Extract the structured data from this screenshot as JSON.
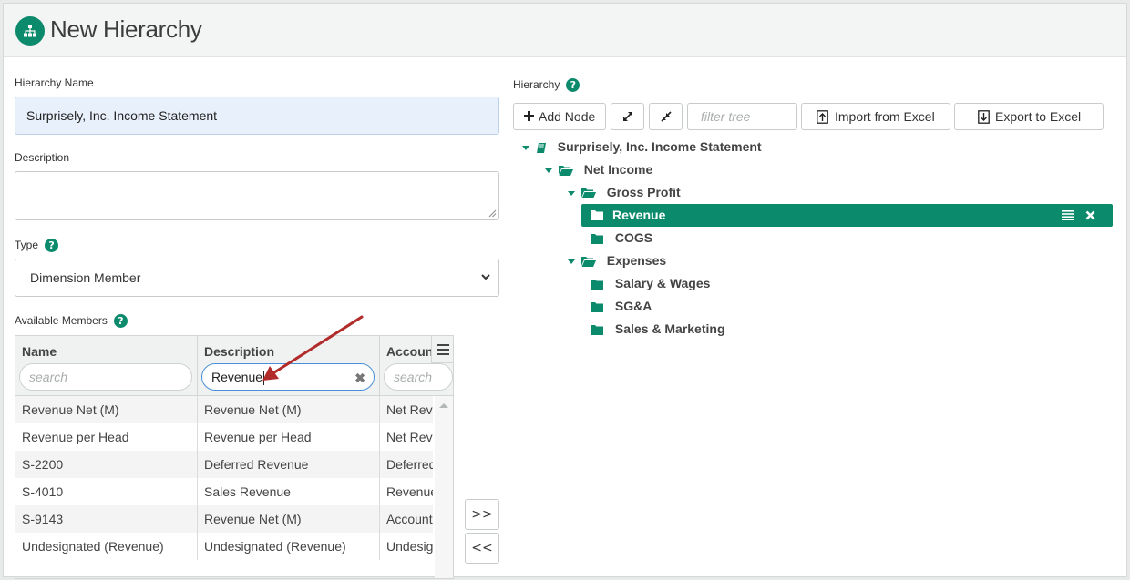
{
  "header": {
    "title": "New Hierarchy",
    "icon": "hierarchy-icon"
  },
  "form": {
    "name_label": "Hierarchy Name",
    "name_value": "Surprisely, Inc. Income Statement",
    "description_label": "Description",
    "description_value": "",
    "type_label": "Type",
    "type_value": "Dimension Member",
    "members_label": "Available Members"
  },
  "grid": {
    "columns": [
      {
        "title": "Name",
        "filter": "",
        "placeholder": "search"
      },
      {
        "title": "Description",
        "filter": "Revenue",
        "placeholder": "search"
      },
      {
        "title": "Account",
        "filter": "",
        "placeholder": "search"
      }
    ],
    "rows": [
      [
        "Revenue Net (M)",
        "Revenue Net (M)",
        "Net Reve"
      ],
      [
        "Revenue per Head",
        "Revenue per Head",
        "Net Reve"
      ],
      [
        "S-2200",
        "Deferred Revenue",
        "Deferred"
      ],
      [
        "S-4010",
        "Sales Revenue",
        "Revenue"
      ],
      [
        "S-9143",
        "Revenue Net (M)",
        "Account"
      ],
      [
        "Undesignated (Revenue)",
        "Undesignated (Revenue)",
        "Undesign"
      ]
    ]
  },
  "move": {
    "add": ">>",
    "remove": "<<"
  },
  "hierarchy": {
    "label": "Hierarchy",
    "add_node": "Add Node",
    "filter_placeholder": "filter tree",
    "import": "Import from Excel",
    "export": "Export to Excel",
    "tree": {
      "root": "Surprisely, Inc. Income Statement",
      "net_income": "Net Income",
      "gross_profit": "Gross Profit",
      "revenue": "Revenue",
      "cogs": "COGS",
      "expenses": "Expenses",
      "salary": "Salary & Wages",
      "sga": "SG&A",
      "sales_marketing": "Sales & Marketing"
    }
  },
  "colors": {
    "accent": "#0c8a6c",
    "arrow": "#b22b2b"
  }
}
